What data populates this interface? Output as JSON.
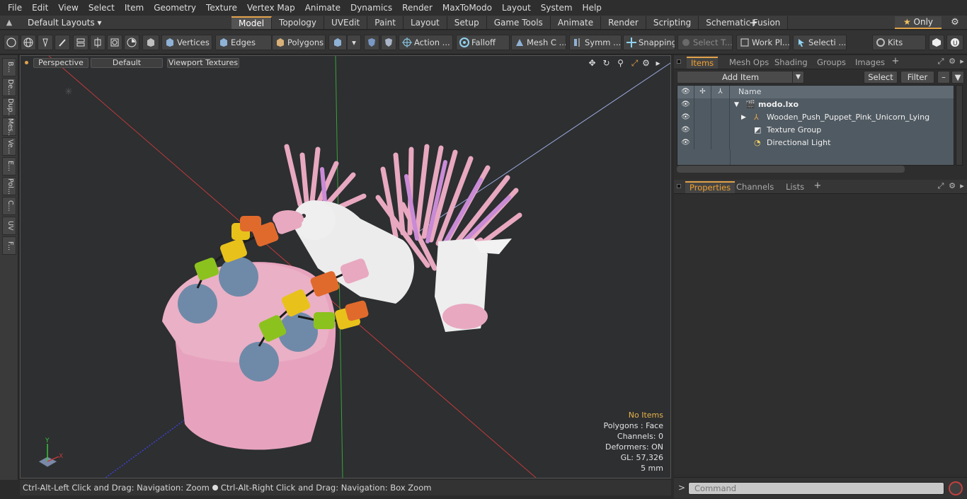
{
  "menu": [
    "File",
    "Edit",
    "View",
    "Select",
    "Item",
    "Geometry",
    "Texture",
    "Vertex Map",
    "Animate",
    "Dynamics",
    "Render",
    "MaxToModo",
    "Layout",
    "System",
    "Help"
  ],
  "layout": {
    "selector": "Default Layouts ▾",
    "only_label": "Only"
  },
  "tabs": [
    {
      "label": "Model",
      "active": true
    },
    {
      "label": "Topology"
    },
    {
      "label": "UVEdit"
    },
    {
      "label": "Paint"
    },
    {
      "label": "Layout"
    },
    {
      "label": "Setup"
    },
    {
      "label": "Game Tools"
    },
    {
      "label": "Animate"
    },
    {
      "label": "Render"
    },
    {
      "label": "Scripting"
    },
    {
      "label": "Schematic Fusion"
    }
  ],
  "toolbar": {
    "vertices": "Vertices",
    "edges": "Edges",
    "polygons": "Polygons",
    "action": "Action ...",
    "falloff": "Falloff",
    "mesh": "Mesh C ...",
    "symm": "Symm ...",
    "snapping": "Snapping",
    "select_t": "Select T...",
    "work_pl": "Work Pl...",
    "selecti": "Selecti ...",
    "kits": "Kits"
  },
  "left_strip": [
    "B...",
    "De...",
    "Dup...",
    "Mes...",
    "Ve...",
    "E...",
    "Pol...",
    "C...",
    "UV",
    "F..."
  ],
  "viewport": {
    "view": "Perspective",
    "shading": "Default",
    "textures": "Viewport Textures",
    "info": {
      "no_items": "No Items",
      "polygons": "Polygons : Face",
      "channels": "Channels: 0",
      "deformers": "Deformers: ON",
      "gl": "GL: 57,326",
      "scale": "5 mm"
    },
    "axis": {
      "x": "X",
      "y": "Y"
    }
  },
  "status": {
    "left": "Ctrl-Alt-Left Click and Drag: Navigation: Zoom",
    "right": "Ctrl-Alt-Right Click and Drag: Navigation: Box Zoom"
  },
  "items_panel": {
    "tabs": [
      "Items",
      "Mesh Ops",
      "Shading",
      "Groups",
      "Images"
    ],
    "add_item": "Add Item",
    "select": "Select",
    "filter": "Filter",
    "name_header": "Name",
    "rows": [
      {
        "name": "modo.lxo"
      },
      {
        "name": "Wooden_Push_Puppet_Pink_Unicorn_Lying"
      },
      {
        "name": "Texture Group"
      },
      {
        "name": "Directional Light"
      }
    ]
  },
  "props_panel": {
    "tabs": [
      "Properties",
      "Channels",
      "Lists"
    ]
  },
  "command": {
    "prompt": ">",
    "placeholder": "Command"
  },
  "colors": {
    "accent": "#e1a24a",
    "pink": "#e8a8c0",
    "blue_bead": "#6f8aa8",
    "orange_bead": "#e06a2c",
    "yellow_bead": "#e8c21a",
    "green_bead": "#8cc21e"
  }
}
